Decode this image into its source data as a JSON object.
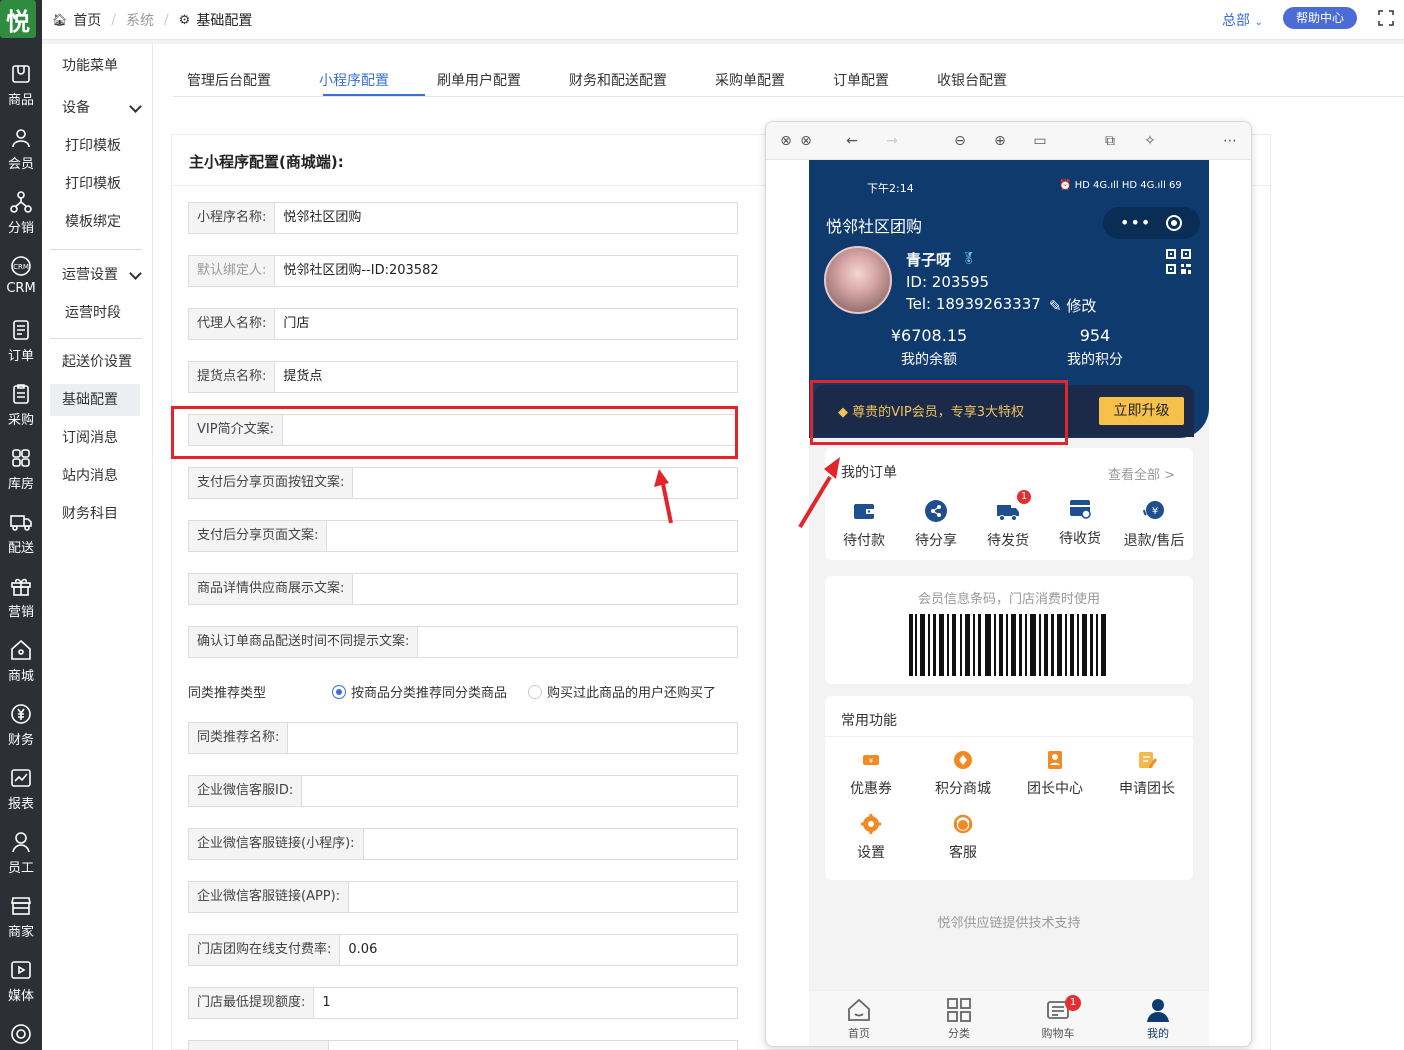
{
  "app": {
    "logo_text": "悦"
  },
  "rail": [
    {
      "label": "商品",
      "icon": "product-icon"
    },
    {
      "label": "会员",
      "icon": "member-icon"
    },
    {
      "label": "分销",
      "icon": "distribution-icon"
    },
    {
      "label": "CRM",
      "icon": "crm-icon"
    },
    {
      "label": "订单",
      "icon": "order-icon"
    },
    {
      "label": "采购",
      "icon": "purchase-icon"
    },
    {
      "label": "库房",
      "icon": "warehouse-icon"
    },
    {
      "label": "配送",
      "icon": "delivery-icon"
    },
    {
      "label": "营销",
      "icon": "gift-icon"
    },
    {
      "label": "商城",
      "icon": "mall-icon"
    },
    {
      "label": "财务",
      "icon": "finance-icon"
    },
    {
      "label": "报表",
      "icon": "report-icon"
    },
    {
      "label": "员工",
      "icon": "staff-icon"
    },
    {
      "label": "商家",
      "icon": "merchant-icon"
    },
    {
      "label": "媒体",
      "icon": "media-icon"
    }
  ],
  "subnav": [
    {
      "label": "功能菜单"
    },
    {
      "label": "设备"
    },
    {
      "label": "打印模板"
    },
    {
      "label": "打印模板"
    },
    {
      "label": "模板绑定"
    },
    {
      "label": "运营设置"
    },
    {
      "label": "运营时段"
    },
    {
      "label": "起送价设置"
    },
    {
      "label": "基础配置"
    },
    {
      "label": "订阅消息"
    },
    {
      "label": "站内消息"
    },
    {
      "label": "财务科目"
    }
  ],
  "topbar": {
    "home": "首页",
    "system": "系统",
    "current": "基础配置",
    "hq": "总部",
    "help": "帮助中心"
  },
  "tabs": [
    "管理后台配置",
    "小程序配置",
    "刷单用户配置",
    "财务和配送配置",
    "采购单配置",
    "订单配置",
    "收银台配置"
  ],
  "active_tab": "小程序配置",
  "card": {
    "title": "主小程序配置(商城端):",
    "fields": [
      {
        "label": "小程序名称:",
        "value": ""
      },
      {
        "label": "默认绑定人:",
        "value": "悦邻社区团购--ID:203582"
      },
      {
        "label": "代理人名称:",
        "value": "门店"
      },
      {
        "label": "提货点名称:",
        "value": "提货点"
      },
      {
        "label": "VIP简介文案:",
        "value": ""
      },
      {
        "label": "支付后分享页面按钮文案:",
        "value": ""
      },
      {
        "label": "支付后分享页面文案:",
        "value": ""
      },
      {
        "label": "商品详情供应商展示文案:",
        "value": ""
      },
      {
        "label": "确认订单商品配送时间不同提示文案:",
        "value": ""
      }
    ],
    "shop_name_value": "悦邻社区团购",
    "recommend": {
      "label": "同类推荐类型",
      "option_a": "按商品分类推荐同分类商品",
      "option_b": "购买过此商品的用户还购买了",
      "selected": "按商品分类推荐同分类商品"
    },
    "fields2": [
      {
        "label": "同类推荐名称:",
        "value": ""
      },
      {
        "label": "企业微信客服ID:",
        "value": ""
      },
      {
        "label": "企业微信客服链接(小程序):",
        "value": ""
      },
      {
        "label": "企业微信客服链接(APP):",
        "value": ""
      },
      {
        "label": "门店团购在线支付费率:",
        "value": "0.06"
      },
      {
        "label": "门店最低提现额度:",
        "value": "1"
      }
    ]
  },
  "phone": {
    "time": "下午2:14",
    "status_icons": "⏰ HD 4G.ıll HD 4G.ıll 69",
    "shop_title": "悦邻社区团购",
    "capsule_dots": "•••",
    "user": {
      "name": "青子呀",
      "id": "ID: 203595",
      "tel": "Tel: 18939263337",
      "edit": "✎ 修改"
    },
    "balance_value": "¥6708.15",
    "balance_label": "我的余额",
    "points_value": "954",
    "points_label": "我的积分",
    "vip_text": "尊贵的VIP会员，专享3大特权",
    "vip_button": "立即升级",
    "orders": {
      "title": "我的订单",
      "more": "查看全部 >",
      "items": [
        {
          "label": "待付款",
          "icon": "wallet-icon"
        },
        {
          "label": "待分享",
          "icon": "share-icon"
        },
        {
          "label": "待发货",
          "icon": "truck-icon",
          "badge": "1"
        },
        {
          "label": "待收货",
          "icon": "box-icon"
        },
        {
          "label": "退款/售后",
          "icon": "refund-icon"
        }
      ]
    },
    "barcode_text": "会员信息条码，门店消费时使用",
    "functions": {
      "title": "常用功能",
      "items": [
        {
          "label": "优惠券",
          "icon": "coupon-icon"
        },
        {
          "label": "积分商城",
          "icon": "points-mall-icon"
        },
        {
          "label": "团长中心",
          "icon": "leader-center-icon"
        },
        {
          "label": "申请团长",
          "icon": "apply-leader-icon"
        },
        {
          "label": "设置",
          "icon": "settings-icon"
        },
        {
          "label": "客服",
          "icon": "service-icon"
        }
      ]
    },
    "support": "悦邻供应链提供技术支持",
    "tabbar": [
      {
        "label": "首页",
        "icon": "home-icon"
      },
      {
        "label": "分类",
        "icon": "grid-icon"
      },
      {
        "label": "购物车",
        "icon": "cart-icon",
        "badge": "1"
      },
      {
        "label": "我的",
        "icon": "user-icon"
      }
    ]
  },
  "colors": {
    "accent": "#3a6fd8",
    "hero": "#0f3a6e",
    "vip_gold": "#f5c14b",
    "highlight_red": "#e3242b",
    "icon_orange": "#f08a24"
  }
}
